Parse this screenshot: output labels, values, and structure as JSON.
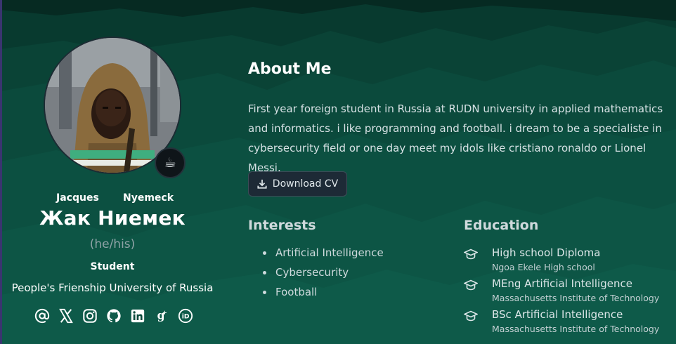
{
  "profile": {
    "first_name": "Jacques",
    "last_name": "Nyemeck",
    "display_name": "Жак Ниемек",
    "pronouns": "(he/his)",
    "role": "Student",
    "organization": "People's Frienship University of Russia",
    "status_emoji": "☕",
    "socials": [
      {
        "name": "email-icon",
        "glyph": "@"
      },
      {
        "name": "x-twitter-icon"
      },
      {
        "name": "instagram-icon"
      },
      {
        "name": "github-icon"
      },
      {
        "name": "linkedin-icon"
      },
      {
        "name": "google-scholar-icon"
      },
      {
        "name": "orcid-icon"
      }
    ]
  },
  "about": {
    "title": "About Me",
    "text": "First year foreign student in Russia at RUDN university in applied mathematics and informatics. i like programming and football. i dream to be a specialiste in cybersecurity field or one day meet my idols like cristiano ronaldo or Lionel Messi.",
    "download_cv_label": "Download CV"
  },
  "interests": {
    "title": "Interests",
    "items": [
      "Artificial Intelligence",
      "Cybersecurity",
      "Football"
    ]
  },
  "education": {
    "title": "Education",
    "items": [
      {
        "degree": "High school Diploma",
        "institution": "Ngoa Ekele High school"
      },
      {
        "degree": "MEng Artificial Intelligence",
        "institution": "Massachusetts Institute of Technology"
      },
      {
        "degree": "BSc Artificial Intelligence",
        "institution": "Massachusetts Institute of Technology"
      }
    ]
  },
  "colors": {
    "background_top": "#073026",
    "background_mid": "#0b4a3c",
    "background_bottom": "#0e5a49",
    "button_bg": "#1d2a36",
    "text_primary": "#ffffff",
    "text_muted": "#8fa3a7"
  }
}
